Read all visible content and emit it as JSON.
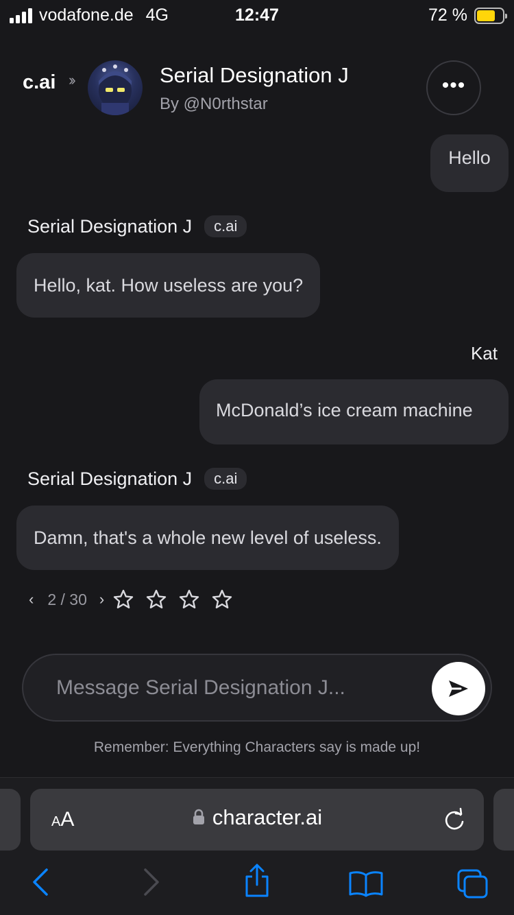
{
  "status_bar": {
    "carrier": "vodafone.de",
    "network": "4G",
    "time": "12:47",
    "battery_percent": "72 %",
    "battery_level": 0.72,
    "battery_color": "#ffd60a"
  },
  "header": {
    "logo": "c.ai",
    "character_name": "Serial Designation J",
    "author": "By @N0rthstar",
    "more_label": "•••"
  },
  "messages": [
    {
      "role": "user",
      "text": "Hello"
    },
    {
      "role": "bot",
      "sender": "Serial Designation J",
      "tag": "c.ai",
      "text": "Hello, kat. How useless are you?"
    },
    {
      "role": "user",
      "sender": "Kat",
      "text": "McDonald’s ice cream machine"
    },
    {
      "role": "bot",
      "sender": "Serial Designation J",
      "tag": "c.ai",
      "text": "Damn, that's a whole new level of useless."
    }
  ],
  "swipe": {
    "prev": "‹",
    "next": "›",
    "counter": "2 / 30",
    "rating_stars": 4,
    "rating_value": 0
  },
  "composer": {
    "placeholder": "Message Serial Designation J..."
  },
  "disclaimer": "Remember: Everything Characters say is made up!",
  "browser": {
    "text_size_label_small": "A",
    "text_size_label_large": "A",
    "url": "character.ai"
  },
  "icons": [
    "signal-icon",
    "battery-icon",
    "chevron-double-right-icon",
    "avatar",
    "more-icon",
    "star-icon",
    "send-icon",
    "lock-icon",
    "reload-icon",
    "back-icon",
    "forward-icon",
    "share-icon",
    "bookmarks-icon",
    "tabs-icon"
  ],
  "colors": {
    "background": "#18181b",
    "bubble": "#2b2b30",
    "safari_blue": "#0a84ff"
  }
}
